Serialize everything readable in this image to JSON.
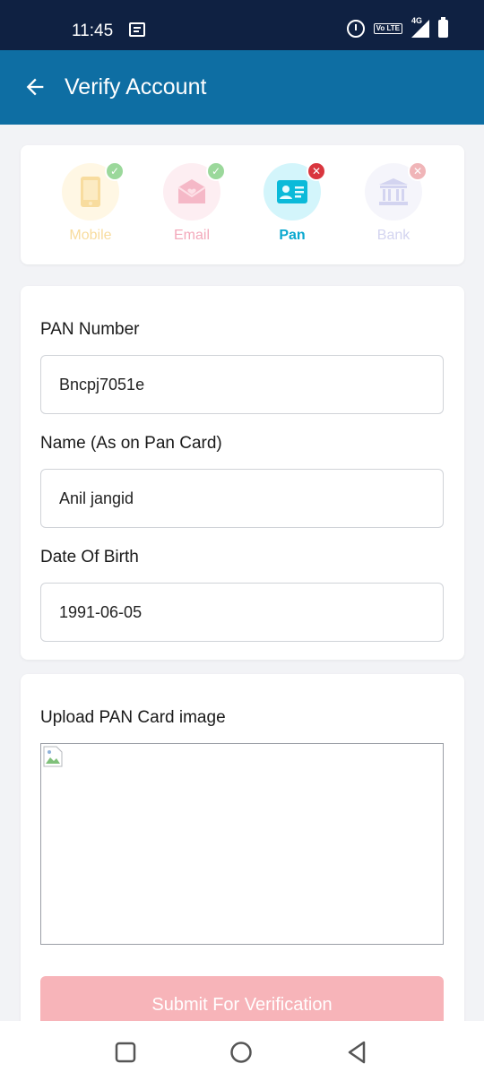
{
  "status_bar": {
    "time": "11:45",
    "icons": [
      "message-icon",
      "alarm-icon",
      "volte-icon",
      "signal-4g-icon",
      "battery-icon"
    ],
    "volte_label": "Vo LTE",
    "network_label": "4G"
  },
  "app_bar": {
    "title": "Verify Account",
    "back_icon": "arrow-left-icon"
  },
  "steps": [
    {
      "label": "Mobile",
      "icon": "phone-icon",
      "status": "done",
      "color": "#f5d48a",
      "bg": "#fff7e4"
    },
    {
      "label": "Email",
      "icon": "envelope-icon",
      "status": "done",
      "color": "#f2a6b8",
      "bg": "#fdeef2"
    },
    {
      "label": "Pan",
      "icon": "id-card-icon",
      "status": "active",
      "color": "#06b8d8",
      "bg": "#d6f6fb"
    },
    {
      "label": "Bank",
      "icon": "bank-icon",
      "status": "pending",
      "color": "#c8c9ee",
      "bg": "#f4f4fb"
    }
  ],
  "form": {
    "pan_label": "PAN Number",
    "pan_value": "Bncpj7051e",
    "name_label": "Name (As on Pan Card)",
    "name_value": "Anil jangid",
    "dob_label": "Date Of Birth",
    "dob_value": "1991-06-05"
  },
  "upload": {
    "label": "Upload PAN Card image",
    "submit_label": "Submit For Verification"
  },
  "colors": {
    "status_bar": "#0f2142",
    "app_bar": "#0e6ea3",
    "check_green": "#8fd28f",
    "error_red": "#d9363e",
    "pending_red": "#f0b5b8",
    "submit_disabled": "#f7b4b9"
  },
  "nav": [
    "recents-square-icon",
    "home-circle-icon",
    "back-triangle-icon"
  ]
}
